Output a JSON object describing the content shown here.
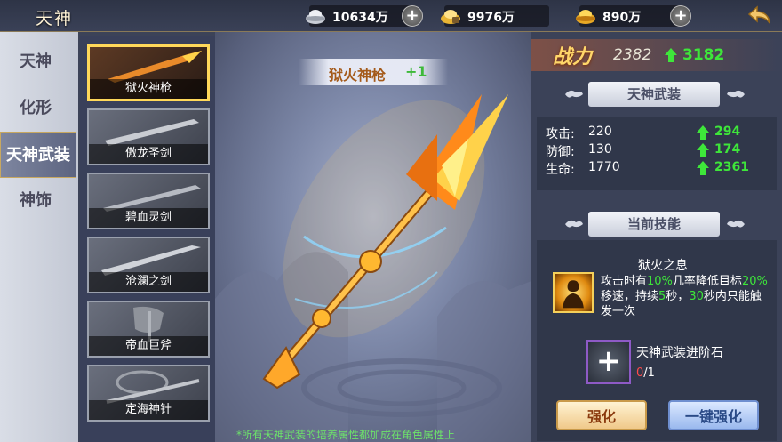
{
  "header": {
    "title": "天神",
    "currencies": [
      {
        "name": "silver",
        "amount": "10634万",
        "icon": "silver-ingot-icon"
      },
      {
        "name": "gold-bound",
        "amount": "9976万",
        "icon": "gold-ingot-lock-icon"
      },
      {
        "name": "gold",
        "amount": "890万",
        "icon": "gold-ingot-icon"
      }
    ],
    "plus_label": "+",
    "back_icon": "back-arrow-icon"
  },
  "tabs": [
    {
      "label": "天神",
      "active": false
    },
    {
      "label": "化形",
      "active": false
    },
    {
      "label": "天神武装",
      "active": true
    },
    {
      "label": "神饰",
      "active": false
    }
  ],
  "equipment": [
    {
      "name": "狱火神枪",
      "selected": true
    },
    {
      "name": "傲龙圣剑",
      "selected": false
    },
    {
      "name": "碧血灵剑",
      "selected": false
    },
    {
      "name": "沧澜之剑",
      "selected": false
    },
    {
      "name": "帝血巨斧",
      "selected": false
    },
    {
      "name": "定海神针",
      "selected": false
    }
  ],
  "display": {
    "weapon_name": "狱火神枪",
    "weapon_level": "+1",
    "footnote": "*所有天神武装的培养属性都加成在角色属性上"
  },
  "power": {
    "label": "战力",
    "value": "2382",
    "gain": "3182"
  },
  "stats": {
    "header": "天神武装",
    "rows": [
      {
        "name": "攻击:",
        "value": "220",
        "gain": "294"
      },
      {
        "name": "防御:",
        "value": "130",
        "gain": "174"
      },
      {
        "name": "生命:",
        "value": "1770",
        "gain": "2361"
      }
    ]
  },
  "skill": {
    "header": "当前技能",
    "name": "狱火之息",
    "desc_parts": [
      {
        "t": "攻击时有",
        "g": false
      },
      {
        "t": "10%",
        "g": true
      },
      {
        "t": "几率降低目标",
        "g": false
      },
      {
        "t": "20%",
        "g": true
      },
      {
        "t": "移速，持续",
        "g": false
      },
      {
        "t": "5",
        "g": true
      },
      {
        "t": "秒，",
        "g": false
      },
      {
        "t": "30",
        "g": true
      },
      {
        "t": "秒内只能触发一次",
        "g": false
      }
    ]
  },
  "upgrade": {
    "stone_name": "天神武装进阶石",
    "have": "0",
    "need": "/1",
    "enhance_label": "强化",
    "enhance_all_label": "一键强化"
  },
  "colors": {
    "accent_gold": "#ffd76a",
    "gain_green": "#3ee63a",
    "shortage_red": "#ff4a4a"
  }
}
